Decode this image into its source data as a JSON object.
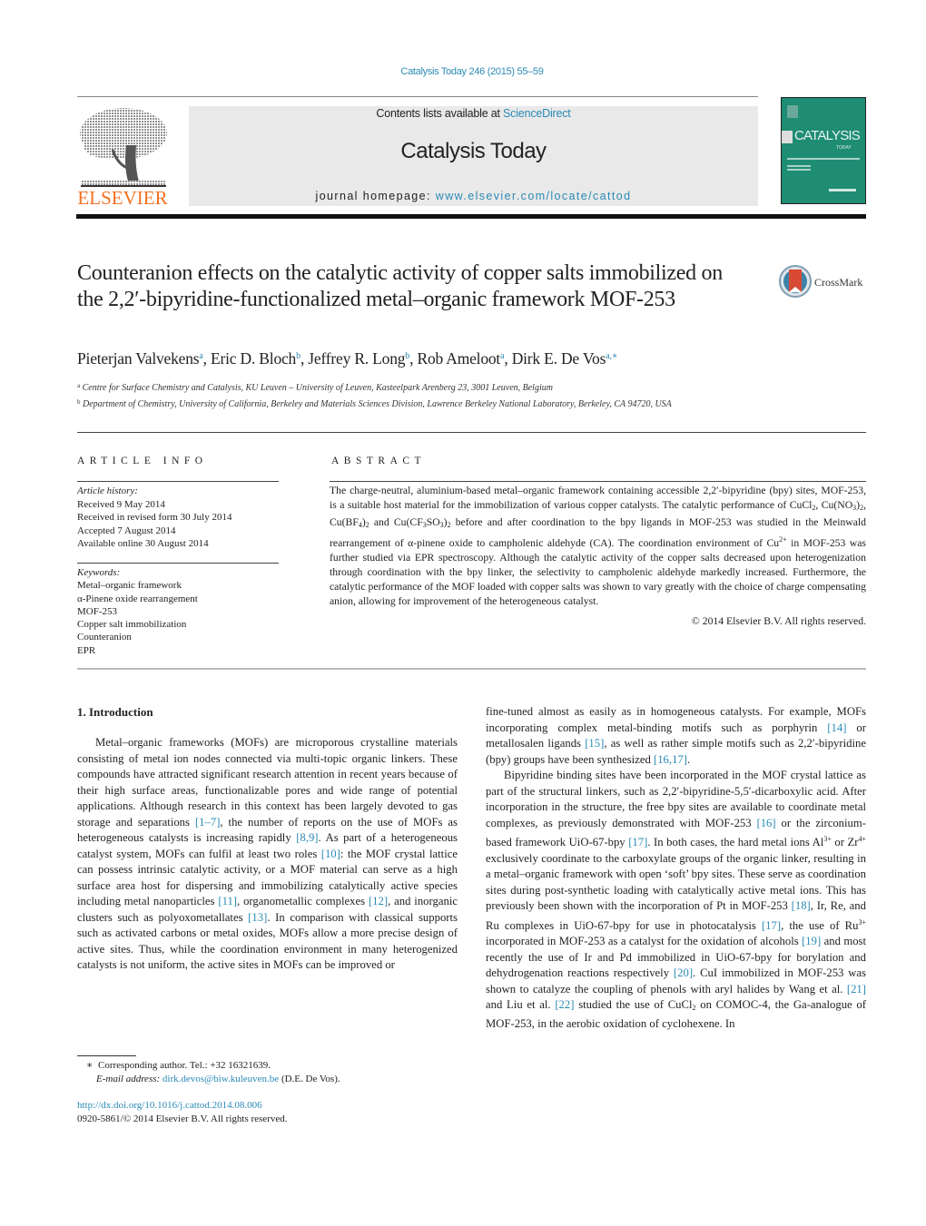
{
  "header": {
    "journal_ref": "Catalysis Today 246 (2015) 55–59",
    "contents_prefix": "Contents lists available at ",
    "contents_link": "ScienceDirect",
    "journal_title": "Catalysis Today",
    "homepage_prefix": "journal homepage: ",
    "homepage_link": "www.elsevier.com/locate/cattod",
    "publisher_logo": "ELSEVIER",
    "cover_title": "CATALYSIS",
    "cover_subtitle": "TODAY",
    "brand_color": "#f37021",
    "link_color": "#2a8ab5",
    "cover_color": "#1f8c74"
  },
  "article": {
    "title": "Counteranion effects on the catalytic activity of copper salts immobilized on the 2,2′-bipyridine-functionalized metal–organic framework MOF-253",
    "crossmark_label": "CrossMark",
    "authors": [
      {
        "name": "Pieterjan Valvekens",
        "sup": "a"
      },
      {
        "name": "Eric D. Bloch",
        "sup": "b"
      },
      {
        "name": "Jeffrey R. Long",
        "sup": "b"
      },
      {
        "name": "Rob Ameloot",
        "sup": "a"
      },
      {
        "name": "Dirk E. De Vos",
        "sup": "a,∗"
      }
    ],
    "affiliations": [
      {
        "mark": "a",
        "text": "Centre for Surface Chemistry and Catalysis, KU Leuven – University of Leuven, Kasteelpark Arenberg 23, 3001 Leuven, Belgium"
      },
      {
        "mark": "b",
        "text": "Department of Chemistry, University of California, Berkeley and Materials Sciences Division, Lawrence Berkeley National Laboratory, Berkeley, CA 94720, USA"
      }
    ]
  },
  "article_info": {
    "heading": "ARTICLE INFO",
    "history_label": "Article history:",
    "history": [
      "Received 9 May 2014",
      "Received in revised form 30 July 2014",
      "Accepted 7 August 2014",
      "Available online 30 August 2014"
    ],
    "keywords_label": "Keywords:",
    "keywords": [
      "Metal–organic framework",
      "α-Pinene oxide rearrangement",
      "MOF-253",
      "Copper salt immobilization",
      "Counteranion",
      "EPR"
    ]
  },
  "abstract": {
    "heading": "ABSTRACT",
    "s1": "The charge-neutral, aluminium-based metal–organic framework containing accessible 2,2′-bipyridine (bpy) sites, MOF-253, is a suitable host material for the immobilization of various copper catalysts. The catalytic performance of CuCl",
    "s2": ", Cu(NO",
    "s3": ")",
    "s4": ", Cu(BF",
    "s5": ")",
    "s6": " and Cu(CF",
    "s7": "SO",
    "s8": ")",
    "s9": " before and after coordination to the bpy ligands in MOF-253 was studied in the Meinwald rearrangement of α-pinene oxide to campholenic aldehyde (CA). The coordination environment of Cu",
    "s10": " in MOF-253 was further studied via EPR spectroscopy. Although the catalytic activity of the copper salts decreased upon heterogenization through coordination with the bpy linker, the selectivity to campholenic aldehyde markedly increased. Furthermore, the catalytic performance of the MOF loaded with copper salts was shown to vary greatly with the choice of charge compensating anion, allowing for improvement of the heterogeneous catalyst.",
    "sub2": "2",
    "sub3": "3",
    "sub4": "4",
    "sup2plus": "2+",
    "copyright": "© 2014 Elsevier B.V. All rights reserved."
  },
  "intro": {
    "heading": "1.  Introduction",
    "left": {
      "t1": "Metal–organic frameworks (MOFs) are microporous crystalline materials consisting of metal ion nodes connected via multi-topic organic linkers. These compounds have attracted significant research attention in recent years because of their high surface areas, functionalizable pores and wide range of potential applications. Although research in this context has been largely devoted to gas storage and separations ",
      "r1": "[1–7]",
      "t2": ", the number of reports on the use of MOFs as heterogeneous catalysts is increasing rapidly ",
      "r2": "[8,9]",
      "t3": ". As part of a heterogeneous catalyst system, MOFs can fulfil at least two roles ",
      "r3": "[10]",
      "t4": ": the MOF crystal lattice can possess intrinsic catalytic activity, or a MOF material can serve as a high surface area host for dispersing and immobilizing catalytically active species including metal nanoparticles ",
      "r4": "[11]",
      "t5": ", organometallic complexes ",
      "r5": "[12]",
      "t6": ", and inorganic clusters such as polyoxometallates ",
      "r6": "[13]",
      "t7": ". In comparison with classical supports such as activated carbons or metal oxides, MOFs allow a more precise design of active sites. Thus, while the coordination environment in many heterogenized catalysts is not uniform, the active sites in MOFs can be improved or"
    },
    "right_p1": {
      "t1": "fine-tuned almost as easily as in homogeneous catalysts. For example, MOFs incorporating complex metal-binding motifs such as porphyrin ",
      "r1": "[14]",
      "t2": " or metallosalen ligands ",
      "r2": "[15]",
      "t3": ", as well as rather simple motifs such as 2,2′-bipyridine (bpy) groups have been synthesized ",
      "r3": "[16,17]",
      "t4": "."
    },
    "right_p2": {
      "t1": "Bipyridine binding sites have been incorporated in the MOF crystal lattice as part of the structural linkers, such as 2,2′-bipyridine-5,5′-dicarboxylic acid. After incorporation in the structure, the free bpy sites are available to coordinate metal complexes, as previously demonstrated with MOF-253 ",
      "r1": "[16]",
      "t2": " or the zirconium-based framework UiO-67-bpy ",
      "r2": "[17]",
      "t3": ". In both cases, the hard metal ions Al",
      "sup1": "3+",
      "t4": " or Zr",
      "sup2": "4+",
      "t5": " exclusively coordinate to the carboxylate groups of the organic linker, resulting in a metal–organic framework with open ‘soft’ bpy sites. These serve as coordination sites during post-synthetic loading with catalytically active metal ions. This has previously been shown with the incorporation of Pt in MOF-253 ",
      "r3": "[18]",
      "t6": ", Ir, Re, and Ru complexes in UiO-67-bpy for use in photocatalysis ",
      "r4": "[17]",
      "t7": ", the use of Ru",
      "sup3": "3+",
      "t8": " incorporated in MOF-253 as a catalyst for the oxidation of alcohols ",
      "r5": "[19]",
      "t9": " and most recently the use of Ir and Pd immobilized in UiO-67-bpy for borylation and dehydrogenation reactions respectively ",
      "r6": "[20]",
      "t10": ". CuI immobilized in MOF-253 was shown to catalyze the coupling of phenols with aryl halides by Wang et al. ",
      "r7": "[21]",
      "t11": " and Liu et al. ",
      "r8": "[22]",
      "t12": " studied the use of CuCl",
      "sub": "2",
      "t13": " on COMOC-4, the Ga-analogue of MOF-253, in the aerobic oxidation of cyclohexene. In"
    }
  },
  "footnotes": {
    "star": "∗",
    "corresponding": "Corresponding author. Tel.: +32 16321639.",
    "email_label": "E-mail address: ",
    "email": "dirk.devos@biw.kuleuven.be",
    "email_suffix": " (D.E. De Vos).",
    "doi": "http://dx.doi.org/10.1016/j.cattod.2014.08.006",
    "issn": "0920-5861/© 2014 Elsevier B.V. All rights reserved."
  }
}
